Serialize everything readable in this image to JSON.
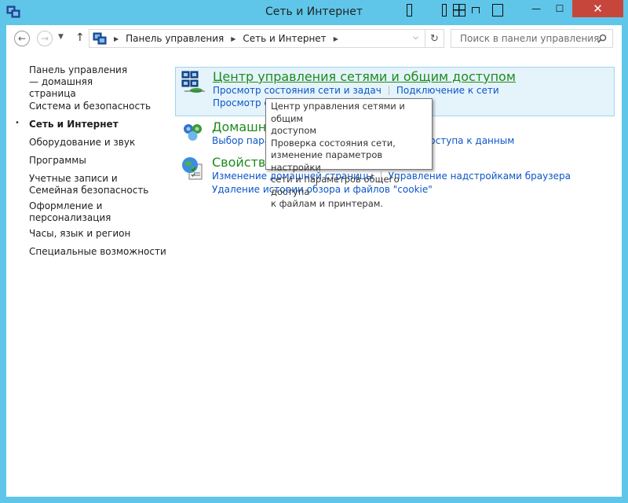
{
  "window": {
    "title": "Сеть и Интернет",
    "close_glyph": "✕",
    "minimize_glyph": "—",
    "maximize_glyph": "☐"
  },
  "nav": {
    "back_glyph": "←",
    "forward_glyph": "→",
    "history_glyph": "▼",
    "up_glyph": "↑"
  },
  "address": {
    "crumbs": [
      "Панель управления",
      "Сеть и Интернет"
    ],
    "separator_glyph": "▶",
    "dropdown_glyph": "⌵",
    "refresh_glyph": "↻"
  },
  "search": {
    "placeholder": "Поиск в панели управления"
  },
  "sidebar": {
    "items": [
      {
        "label": "Панель управления — домашняя страница",
        "active": false
      },
      {
        "label": "Система и безопасность",
        "active": false
      },
      {
        "label": "Сеть и Интернет",
        "active": true
      },
      {
        "label": "Оборудование и звук",
        "active": false
      },
      {
        "label": "Программы",
        "active": false
      },
      {
        "label": "Учетные записи и Семейная безопасность",
        "active": false
      },
      {
        "label": "Оформление и персонализация",
        "active": false
      },
      {
        "label": "Часы, язык и регион",
        "active": false
      },
      {
        "label": "Специальные возможности",
        "active": false
      }
    ],
    "bullet": "•"
  },
  "categories": [
    {
      "title": "Центр управления сетями и общим доступом",
      "links": [
        "Просмотр состояния сети и задач",
        "Подключение к сети",
        "Просмотр сетевых компьютеров и устройств"
      ],
      "visible_links": [
        "Просмотр состояния сети и задач",
        "Подключение к сети",
        "Просмотр с"
      ]
    },
    {
      "title": "Домашняя группа",
      "visible_title": "Домашн",
      "links": [
        "Выбор пара",
        "доступа к данным"
      ]
    },
    {
      "title": "Свойства браузера",
      "visible_title": "Свойства",
      "links": [
        "Изменение домашней страницы",
        "Управление надстройками браузера",
        "Удаление истории обзора и файлов \"cookie\""
      ]
    }
  ],
  "tooltip": {
    "lines": [
      "Центр управления сетями и общим",
      "доступом",
      "Проверка состояния сети,",
      "изменение параметров настройки",
      "сети и параметров общего доступа",
      "к файлам и принтерам."
    ]
  },
  "colors": {
    "frame": "#5fc6e9",
    "close": "#c7463c",
    "link": "#0c56c8",
    "category_title": "#1e8a1e",
    "selection_bg": "#e5f3fb"
  },
  "icons": {
    "title": "network-control-panel-icon",
    "network_center": "network-center-icon",
    "homegroup": "homegroup-icon",
    "internet_options": "internet-options-icon"
  }
}
